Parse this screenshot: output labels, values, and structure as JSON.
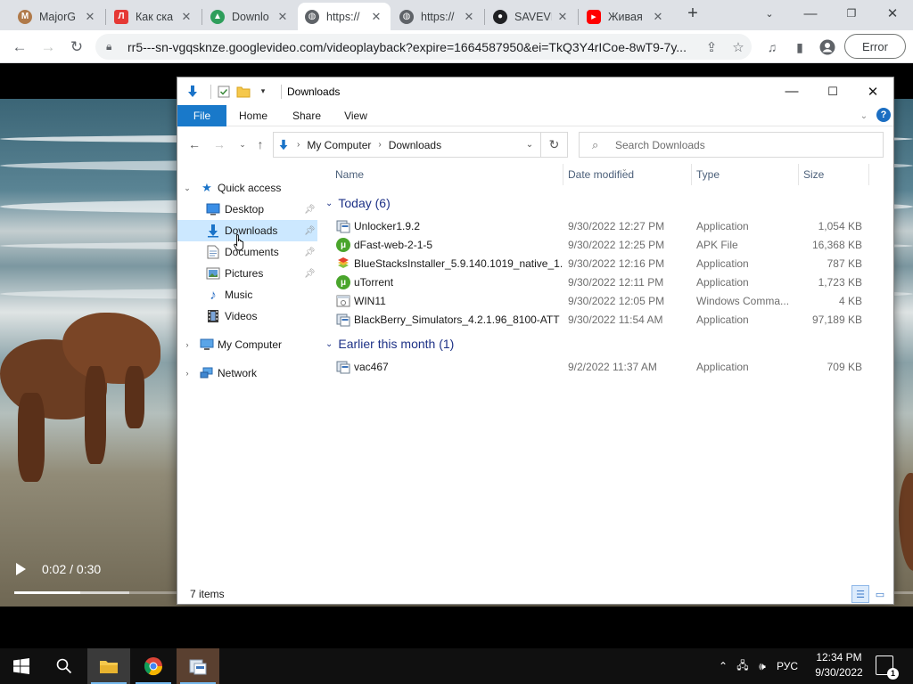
{
  "browser": {
    "tabs": [
      {
        "title": "MajorG",
        "favicon": "majorgeeks-icon",
        "color": "#b07a4a",
        "glyph": "M"
      },
      {
        "title": "Как ска",
        "favicon": "yandex-icon",
        "color": "#e53935",
        "glyph": "Л"
      },
      {
        "title": "Downlo",
        "favicon": "drive-icon",
        "color": "#2e9e5b",
        "glyph": "▲"
      },
      {
        "title": "https://",
        "favicon": "globe-icon",
        "color": "#5f6368",
        "glyph": "◍",
        "active": true
      },
      {
        "title": "https://",
        "favicon": "globe-icon",
        "color": "#5f6368",
        "glyph": "◍"
      },
      {
        "title": "SAVEVI",
        "favicon": "savevideo-icon",
        "color": "#202124",
        "glyph": "●"
      },
      {
        "title": "Живая",
        "favicon": "youtube-icon",
        "color": "#ff0000",
        "glyph": "▶"
      }
    ],
    "url": "rr5---sn-vgqsknze.googlevideo.com/videoplayback?expire=1664587950&ei=TkQ3Y4rICoe-8wT9-7y...",
    "profile_button": "Error"
  },
  "video": {
    "time": "0:02 / 0:30",
    "played_fraction": 0.08,
    "buffered_fraction": 0.14
  },
  "explorer": {
    "window_title": "Downloads",
    "ribbon_tabs": [
      "File",
      "Home",
      "Share",
      "View"
    ],
    "breadcrumb": [
      "My Computer",
      "Downloads"
    ],
    "search_placeholder": "Search Downloads",
    "nav": {
      "quick_access": "Quick access",
      "items": [
        {
          "label": "Desktop",
          "icon": "desktop-icon",
          "pinned": true
        },
        {
          "label": "Downloads",
          "icon": "download-arrow-icon",
          "pinned": true,
          "selected": true
        },
        {
          "label": "Documents",
          "icon": "documents-icon",
          "pinned": true
        },
        {
          "label": "Pictures",
          "icon": "pictures-icon",
          "pinned": true
        },
        {
          "label": "Music",
          "icon": "music-note-icon"
        },
        {
          "label": "Videos",
          "icon": "videos-icon"
        }
      ],
      "my_computer": "My Computer",
      "network": "Network"
    },
    "columns": [
      "Name",
      "Date modified",
      "Type",
      "Size"
    ],
    "groups": [
      {
        "label": "Today (6)",
        "files": [
          {
            "name": "Unlocker1.9.2",
            "date": "9/30/2022 12:27 PM",
            "type": "Application",
            "size": "1,054 KB",
            "icon": "installer-icon"
          },
          {
            "name": "dFast-web-2-1-5",
            "date": "9/30/2022 12:25 PM",
            "type": "APK File",
            "size": "16,368 KB",
            "icon": "utorrent-icon"
          },
          {
            "name": "BlueStacksInstaller_5.9.140.1019_native_1...",
            "date": "9/30/2022 12:16 PM",
            "type": "Application",
            "size": "787 KB",
            "icon": "bluestacks-icon"
          },
          {
            "name": "uTorrent",
            "date": "9/30/2022 12:11 PM",
            "type": "Application",
            "size": "1,723 KB",
            "icon": "utorrent-icon"
          },
          {
            "name": "WIN11",
            "date": "9/30/2022 12:05 PM",
            "type": "Windows Comma...",
            "size": "4 KB",
            "icon": "cmd-icon"
          },
          {
            "name": "BlackBerry_Simulators_4.2.1.96_8100-ATT",
            "date": "9/30/2022 11:54 AM",
            "type": "Application",
            "size": "97,189 KB",
            "icon": "installer-icon"
          }
        ]
      },
      {
        "label": "Earlier this month (1)",
        "files": [
          {
            "name": "vac467",
            "date": "9/2/2022 11:37 AM",
            "type": "Application",
            "size": "709 KB",
            "icon": "installer-icon"
          }
        ]
      }
    ],
    "status": "7 items"
  },
  "taskbar": {
    "language": "РУС",
    "time": "12:34 PM",
    "date": "9/30/2022",
    "notifications": "1"
  }
}
